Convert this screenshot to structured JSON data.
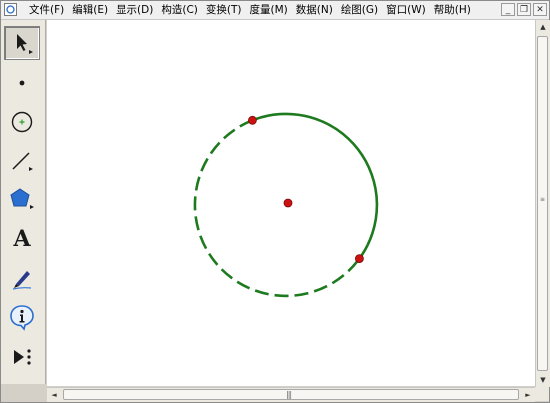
{
  "menu": {
    "items": [
      "文件(F)",
      "编辑(E)",
      "显示(D)",
      "构造(C)",
      "变换(T)",
      "度量(M)",
      "数据(N)",
      "绘图(G)",
      "窗口(W)",
      "帮助(H)"
    ]
  },
  "window_controls": {
    "minimize": "_",
    "restore": "❐",
    "close": "✕"
  },
  "toolbox": {
    "tools": [
      "arrow-select",
      "point",
      "compass",
      "straightedge",
      "polygon",
      "text",
      "marker",
      "information",
      "custom"
    ],
    "selected": "arrow-select",
    "text_tool_glyph": "A"
  },
  "canvas": {
    "circle_color": "#1e7a1e",
    "point_color": "#cc1111",
    "circle_style": "dashed arc with solid arc between two points"
  },
  "scrollbars": {
    "up": "▲",
    "down": "▼",
    "left": "◄",
    "right": "►"
  }
}
